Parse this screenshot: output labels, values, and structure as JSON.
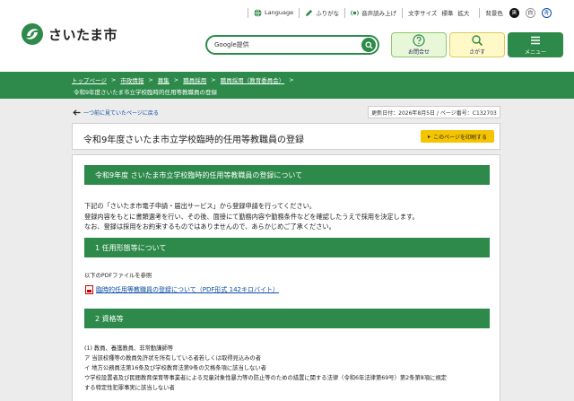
{
  "header": {
    "logo_text": "さいたま市",
    "util": {
      "language": "Language",
      "furigana": "ふりがな",
      "voice": "音声読み上げ",
      "font_size_label": "文字サイズ",
      "font_standard": "標準",
      "font_large": "拡大",
      "bg_color_label": "背景色",
      "bg_black": "黒",
      "bg_white": "白",
      "bg_blue": "青"
    },
    "search": {
      "placeholder": "Google提供"
    },
    "buttons": {
      "contact": "お問合せ",
      "find": "さがす",
      "menu": "メニュー"
    }
  },
  "breadcrumb": {
    "items": [
      "トップページ",
      "市政情報",
      "募集",
      "職員採用",
      "職員採用（教育委員会）"
    ],
    "current": "令和9年度さいたま市立学校臨時的任用等教職員の登録"
  },
  "nav": {
    "back_link": "一つ前に見ていたページに戻る"
  },
  "meta": {
    "text": "更新日付：2026年8月5日 / ページ番号：C132703"
  },
  "page": {
    "title": "令和9年度さいたま市立学校臨時的任用等教職員の登録",
    "print_label": "このページを印刷する"
  },
  "sections": {
    "s0": {
      "heading": "令和9年度 さいたま市立学校臨時的任用等教職員の登録について",
      "lines": [
        "下記の「さいたま市電子申請・届出サービス」から登録申請を行ってください。",
        "登録内容をもとに書類選考を行い、その後、面接にて勤務内容や勤務条件などを確認したうえで採用を決定します。",
        "なお、登録は採用をお約束するものではありませんので、あらかじめご了承ください。"
      ]
    },
    "s1": {
      "heading": "1 任用形態等について",
      "intro": "以下のPDFファイルを参照",
      "pdf_link": "臨時的任用等教職員の登録について（PDF形式 142キロバイト）"
    },
    "s2": {
      "heading": "2 資格等",
      "lines": [
        "(1) 教員、養護教員、非常勤講師等",
        "ア 当該校種等の教員免許状を所有している者若しくは取得見込みの者",
        "イ 地方公務員法第16条及び学校教育法第9条の欠格条項に該当しない者",
        "ウ学校設置者及び民間教育保育等事業者による児童対象性暴力等の防止等のための措置に関する法律（令和6年法律第69号）第2条第8項に規定",
        "する特定性犯罪事実に該当しない者"
      ]
    }
  },
  "colors": {
    "brand_green": "#2d8a4a",
    "print_yellow": "#f5c400",
    "link_blue": "#0a4da3"
  }
}
